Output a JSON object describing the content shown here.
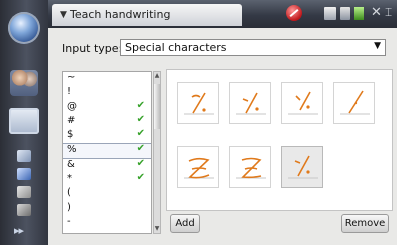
{
  "window": {
    "title": "Teach handwriting"
  },
  "input_type": {
    "label": "Input type:",
    "value": "Special characters"
  },
  "characters": [
    {
      "char": "~",
      "taught": false
    },
    {
      "char": "!",
      "taught": false
    },
    {
      "char": "@",
      "taught": true
    },
    {
      "char": "#",
      "taught": true
    },
    {
      "char": "$",
      "taught": true
    },
    {
      "char": "%",
      "taught": true,
      "selected": true
    },
    {
      "char": "&",
      "taught": true
    },
    {
      "char": "*",
      "taught": true
    },
    {
      "char": "(",
      "taught": false
    },
    {
      "char": ")",
      "taught": false
    },
    {
      "char": "-",
      "taught": false
    }
  ],
  "checkmark": "✔",
  "samples_count": 7,
  "selected_sample_index": 6,
  "buttons": {
    "add": "Add",
    "remove": "Remove"
  },
  "colors": {
    "ink": "#e07a1c",
    "check": "#37a22b"
  }
}
